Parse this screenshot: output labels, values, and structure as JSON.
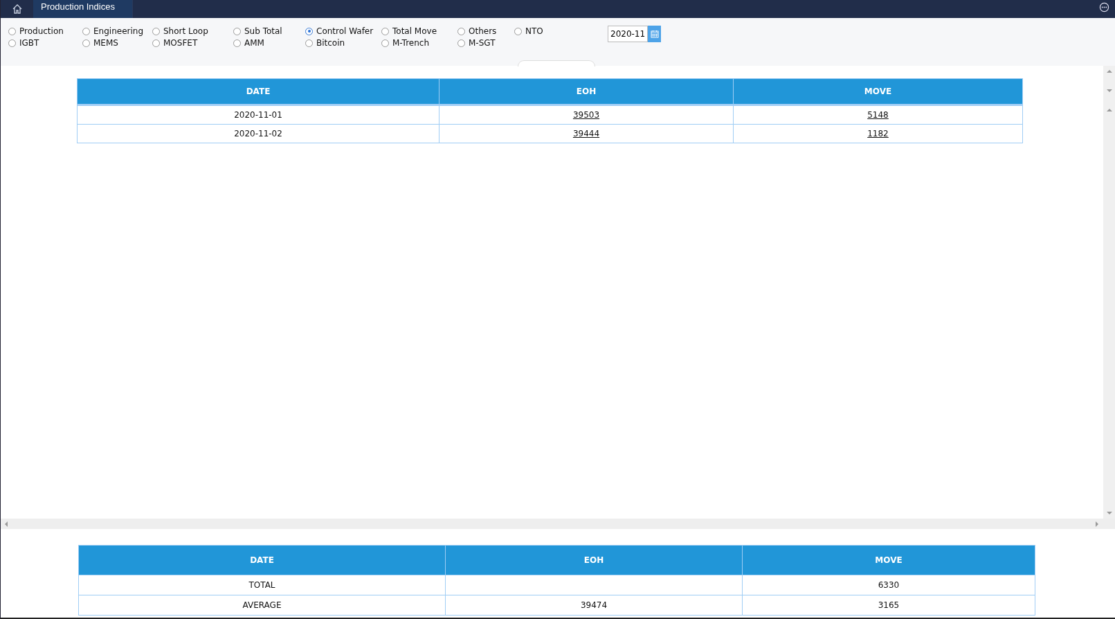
{
  "tabs": [
    {
      "label": "Production Indices",
      "selected": true
    }
  ],
  "filters": [
    {
      "label": "Production",
      "selected": false
    },
    {
      "label": "Engineering",
      "selected": false
    },
    {
      "label": "Short Loop",
      "selected": false
    },
    {
      "label": "Sub Total",
      "selected": false
    },
    {
      "label": "Control Wafer",
      "selected": true
    },
    {
      "label": "Total Move",
      "selected": false
    },
    {
      "label": "Others",
      "selected": false
    },
    {
      "label": "NTO",
      "selected": false
    },
    {
      "label": "IGBT",
      "selected": false
    },
    {
      "label": "MEMS",
      "selected": false
    },
    {
      "label": "MOSFET",
      "selected": false
    },
    {
      "label": "AMM",
      "selected": false
    },
    {
      "label": "Bitcoin",
      "selected": false
    },
    {
      "label": "M-Trench",
      "selected": false
    },
    {
      "label": "M-SGT",
      "selected": false
    }
  ],
  "month_field": {
    "value": "2020-11"
  },
  "table": {
    "columns": [
      "DATE",
      "EOH",
      "MOVE"
    ],
    "rows": [
      [
        {
          "text": "2020-11-01",
          "link": false
        },
        {
          "text": "39503",
          "link": true
        },
        {
          "text": "5148",
          "link": true
        }
      ],
      [
        {
          "text": "2020-11-02",
          "link": false
        },
        {
          "text": "39444",
          "link": true
        },
        {
          "text": "1182",
          "link": true
        }
      ]
    ]
  },
  "summary_table": {
    "columns": [
      "DATE",
      "EOH",
      "MOVE"
    ],
    "rows": [
      [
        "TOTAL",
        null,
        "6330"
      ],
      [
        "AVERAGE",
        "39474",
        "3165"
      ]
    ]
  }
}
